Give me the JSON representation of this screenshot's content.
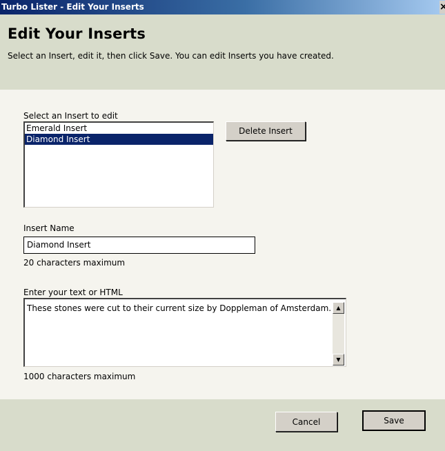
{
  "window": {
    "title": "Turbo Lister - Edit Your Inserts",
    "close_label": "×"
  },
  "header": {
    "heading": "Edit Your Inserts",
    "subtitle": "Select an Insert, edit it, then click Save. You can edit Inserts you have created."
  },
  "inserts": {
    "label": "Select an Insert to edit",
    "items": [
      {
        "label": "Emerald Insert",
        "selected": false
      },
      {
        "label": "Diamond Insert",
        "selected": true
      }
    ],
    "delete_label": "Delete Insert"
  },
  "insert_name": {
    "label": "Insert Name",
    "value": "Diamond Insert",
    "hint": "20 characters maximum"
  },
  "insert_text": {
    "label": "Enter your text or HTML",
    "value": "These stones were cut to their current size by Doppleman of Amsterdam.",
    "hint": "1000 characters maximum"
  },
  "footer": {
    "cancel_label": "Cancel",
    "save_label": "Save"
  },
  "icons": {
    "scroll_up": "▲",
    "scroll_down": "▼"
  }
}
